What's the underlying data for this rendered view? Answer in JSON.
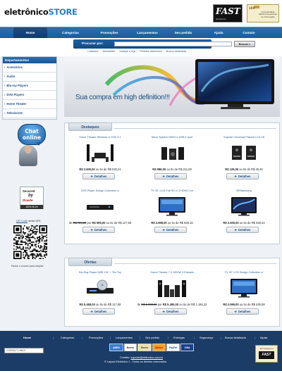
{
  "header": {
    "logo_part1": "eletrônico",
    "logo_part2": "STORE",
    "fast_logo": "FAST",
    "fast_sub": "eletrônicos",
    "seal_badge": "100",
    "seal_text": "Conectividade Máxima Segurança de Informação"
  },
  "nav": [
    "Home",
    "Categorias",
    "Promoções",
    "Lançamentos",
    "Seu pedido",
    "Ajuda",
    "Contato"
  ],
  "search": {
    "label": "Procurar por:",
    "placeholder": "",
    "button": "Buscar"
  },
  "quick_links": [
    "Cadastro",
    "Newsletter",
    "Indique a loja",
    "Pedidos anteriores",
    "Busca detalhada"
  ],
  "sidebar": {
    "departments_title": "Departamentos",
    "departments": [
      "Acessórios",
      "Áudio",
      "Blu-ray Players",
      "DVD Players",
      "Home Theater",
      "Televisores"
    ],
    "chat": {
      "line1": "Chat",
      "line2": "online"
    },
    "secured": {
      "l1": "Secured",
      "l2": "by",
      "l3": "thawte",
      "date": "2009-05-29"
    },
    "qr_text": {
      "link": "QR-Code",
      "rest": " desta URL"
    },
    "qr_caption": "Passe o mouse para ampliar"
  },
  "banner": {
    "text": "Sua compra em high definition!!!"
  },
  "destaques": {
    "title": "Destaques",
    "products": [
      {
        "name": "Home Theater Wireless c/ DVD 5.1",
        "old": "",
        "price": "R$ 2.500,00",
        "installments": " ou 5x de R$ 530,24",
        "button": "Detalhes",
        "icon": "home-theater-icon"
      },
      {
        "name": "Micro System HDMI c/ USB e Ipod",
        "old": "",
        "price": "R$ 999,00",
        "installments": " ou 5x de R$ 211,08",
        "button": "Detalhes",
        "icon": "micro-system-icon"
      },
      {
        "name": "Suporte Universal Plasma LCD 18",
        "old": "",
        "price": "R$ 129,00",
        "installments": " ou 5x de R$ 25,45",
        "button": "Detalhes",
        "icon": "wall-mount-icon"
      },
      {
        "name": "DVD Player Design Collection c/",
        "old": "R$ 799,00",
        "price": "R$ 599,00",
        "installments": " ou 5x de R$ 127,05",
        "button": "Detalhes",
        "icon": "dvd-player-icon"
      },
      {
        "name": "TV 32\" LCD Full HD c/ 3 HDMI Con",
        "old": "",
        "price": "R$ 3.999,00",
        "installments": " ou 5x de R$ 848,18",
        "button": "Detalhes",
        "icon": "lcd-tv-icon"
      },
      {
        "name": "BRSamsung",
        "old": "",
        "price": "R$ 2.500,00",
        "installments": " ou 5x de R$ 530,24",
        "button": "Detalhes",
        "icon": "led-tv-icon"
      }
    ]
  },
  "ofertas": {
    "title": "Ofertas",
    "products": [
      {
        "name": "Blu Ray Player DBR-10C + Ten Toy",
        "old": "",
        "price": "R$ 5.465,00",
        "installments": " ou 5x de R$ 117,08",
        "button": "Detalhes",
        "icon": "blu-ray-icon"
      },
      {
        "name": "Home Theater 7.2 1000W 3 Entrada",
        "old": "R$ 5.990,00",
        "price": "R$ 5.490,00",
        "installments": " ou 5x de R$ 1.166,32",
        "button": "Detalhes",
        "icon": "speaker-system-icon"
      },
      {
        "name": "TV 32\" LCD Design Collection c/",
        "old": "",
        "price": "R$ 2.999,00",
        "installments": " ou 5x de R$ 636,08",
        "button": "Detalhes",
        "icon": "lcd-tv-icon"
      }
    ]
  },
  "footer": {
    "links": [
      "Home",
      "Categorias",
      "Promoções",
      "Lançamentos",
      "Seu pedido",
      "Entregas",
      "Segurança",
      "Busca detalhada",
      "Ajuda"
    ],
    "contact_badge": "CONTACT LINKS",
    "contact_label": "Contato: ",
    "contact_email": "suporte@eletronico.com.br",
    "copyright": "© Layout Eletrônico 1 - Todos os direitos reservados",
    "payments": [
      "AMEX",
      "Boleto",
      "Diners",
      "Master",
      "PayPal",
      "VISA"
    ],
    "seal_title": "Tecnologia por",
    "seal_mark": "FAST"
  },
  "colors": {
    "brand_blue": "#2a6fb5",
    "nav_dark": "#1b3c66",
    "link": "#2b5d93"
  }
}
